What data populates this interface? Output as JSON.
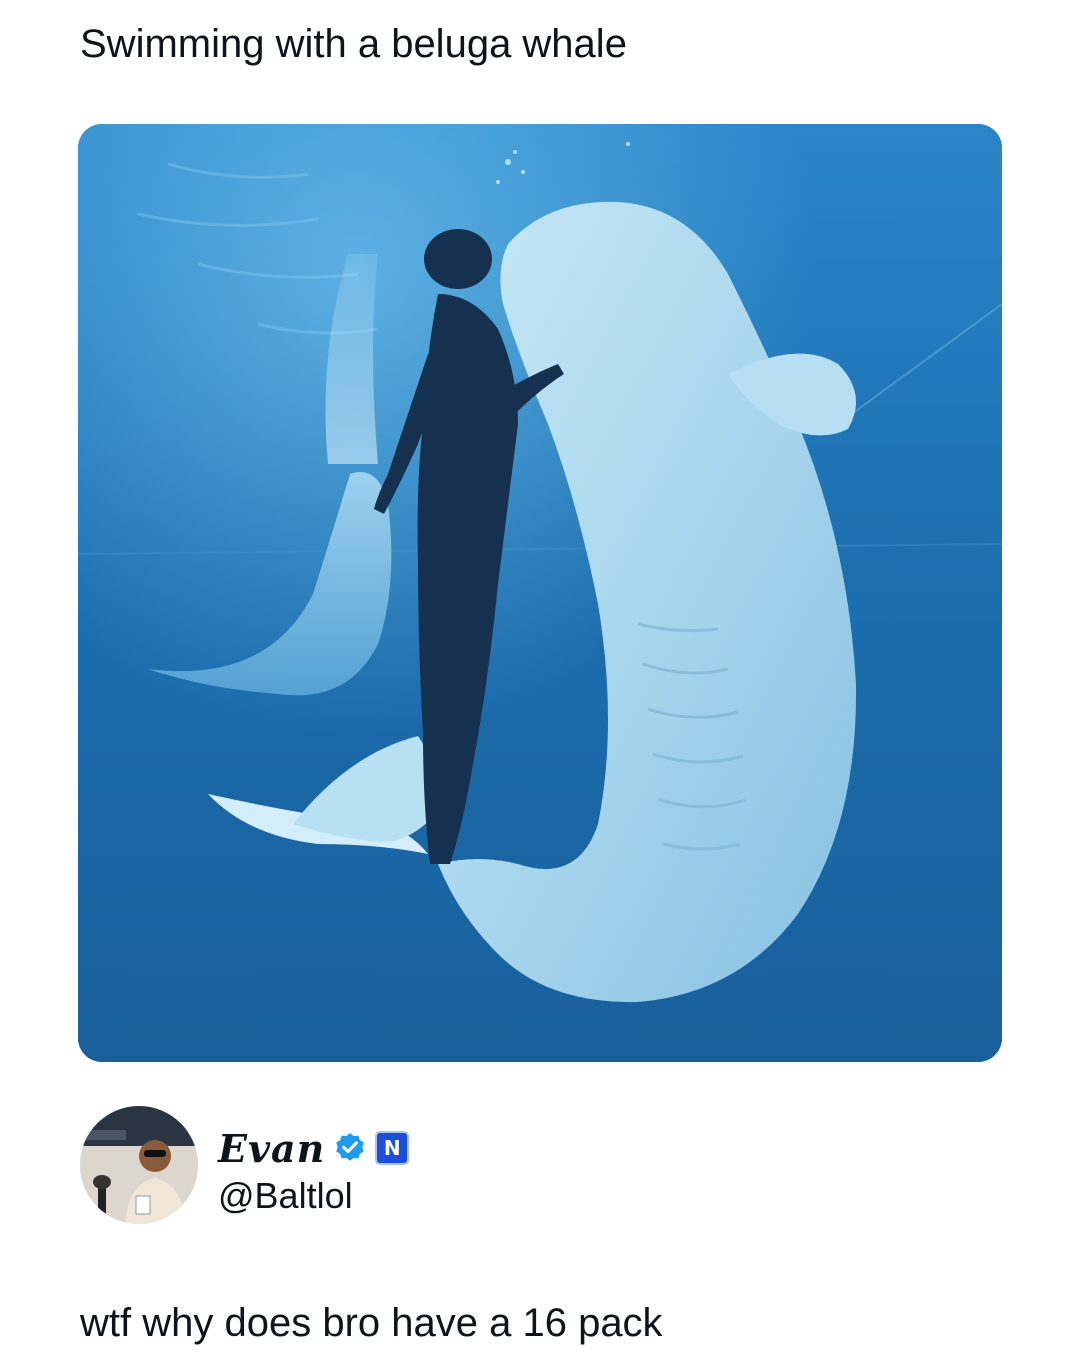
{
  "quoted_post": {
    "text": "Swimming with a beluga whale"
  },
  "media": {
    "alt": "Underwater photo of a diver and beluga whales in an aquarium"
  },
  "author": {
    "display_name": "Evan",
    "handle": "@Baltlol",
    "verified": true,
    "affiliate_badge_letter": "N"
  },
  "post": {
    "text": "wtf why does bro have a 16 pack"
  },
  "colors": {
    "text": "#0f1419",
    "verified_blue": "#1d9bf0",
    "water_blue": "#1f76b6"
  }
}
